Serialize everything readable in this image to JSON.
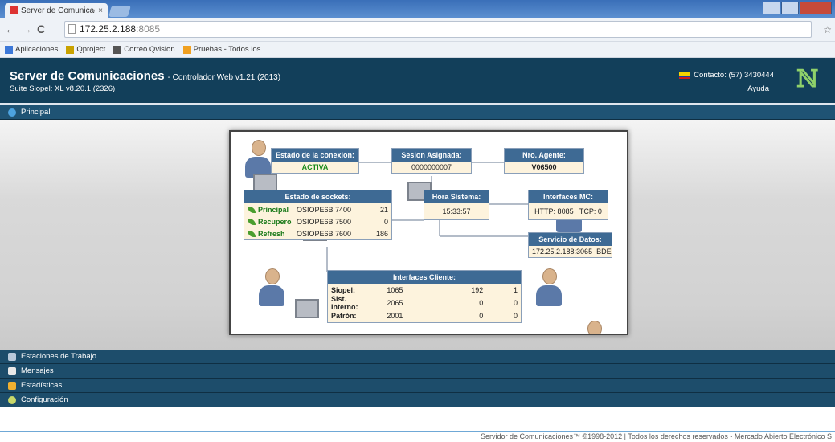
{
  "browser": {
    "tab_title": "Server de Comunicacion",
    "tab_close": "×",
    "url_host": "172.25.2.188",
    "url_port": ":8085",
    "bookmarks": [
      {
        "label": "Aplicaciones",
        "color": "#3c78d8"
      },
      {
        "label": "Qproject",
        "color": "#c9a200"
      },
      {
        "label": "Correo Qvision",
        "color": "#555555"
      },
      {
        "label": "Pruebas - Todos los",
        "color": "#f0a020"
      }
    ]
  },
  "header": {
    "title": "Server de Comunicaciones",
    "version": "- Controlador Web v1.21 (2013)",
    "subtitle": "Suite Siopel: XL v8.20.1 (2326)",
    "contact": "Contacto: (57) 3430444",
    "help": "Ayuda"
  },
  "sections": {
    "principal": "Principal",
    "estaciones": "Estaciones de Trabajo",
    "mensajes": "Mensajes",
    "estadisticas": "Estadísticas",
    "configuracion": "Configuración"
  },
  "diagram": {
    "estado_conexion": {
      "title": "Estado de la conexion:",
      "value": "ACTIVA"
    },
    "sesion": {
      "title": "Sesion Asignada:",
      "value": "0000000007"
    },
    "agente": {
      "title": "Nro. Agente:",
      "value": "V06500"
    },
    "sockets": {
      "title": "Estado de sockets:",
      "rows": [
        {
          "name": "Principal",
          "server": "OSIOPE6B 7400",
          "value": "21"
        },
        {
          "name": "Recupero",
          "server": "OSIOPE6B 7500",
          "value": "0"
        },
        {
          "name": "Refresh",
          "server": "OSIOPE6B 7600",
          "value": "186"
        }
      ]
    },
    "hora": {
      "title": "Hora Sistema:",
      "value": "15:33:57"
    },
    "interfaces_mc": {
      "title": "Interfaces MC:",
      "value": "HTTP: 8085   TCP: 0"
    },
    "servicio_datos": {
      "title": "Servicio de Datos:",
      "value": "172.25.2.188:3065  BDE"
    },
    "interfaces_cliente": {
      "title": "Interfaces Cliente:",
      "rows": [
        {
          "name": "Siopel:",
          "c1": "1065",
          "c2": "192",
          "c3": "1"
        },
        {
          "name": "Sist. Interno:",
          "c1": "2065",
          "c2": "0",
          "c3": "0"
        },
        {
          "name": "Patrón:",
          "c1": "2001",
          "c2": "0",
          "c3": "0"
        }
      ]
    }
  },
  "footer": "Servidor de Comunicaciones™ ©1998-2012 | Todos los derechos reservados - Mercado Abierto Electrónico S"
}
